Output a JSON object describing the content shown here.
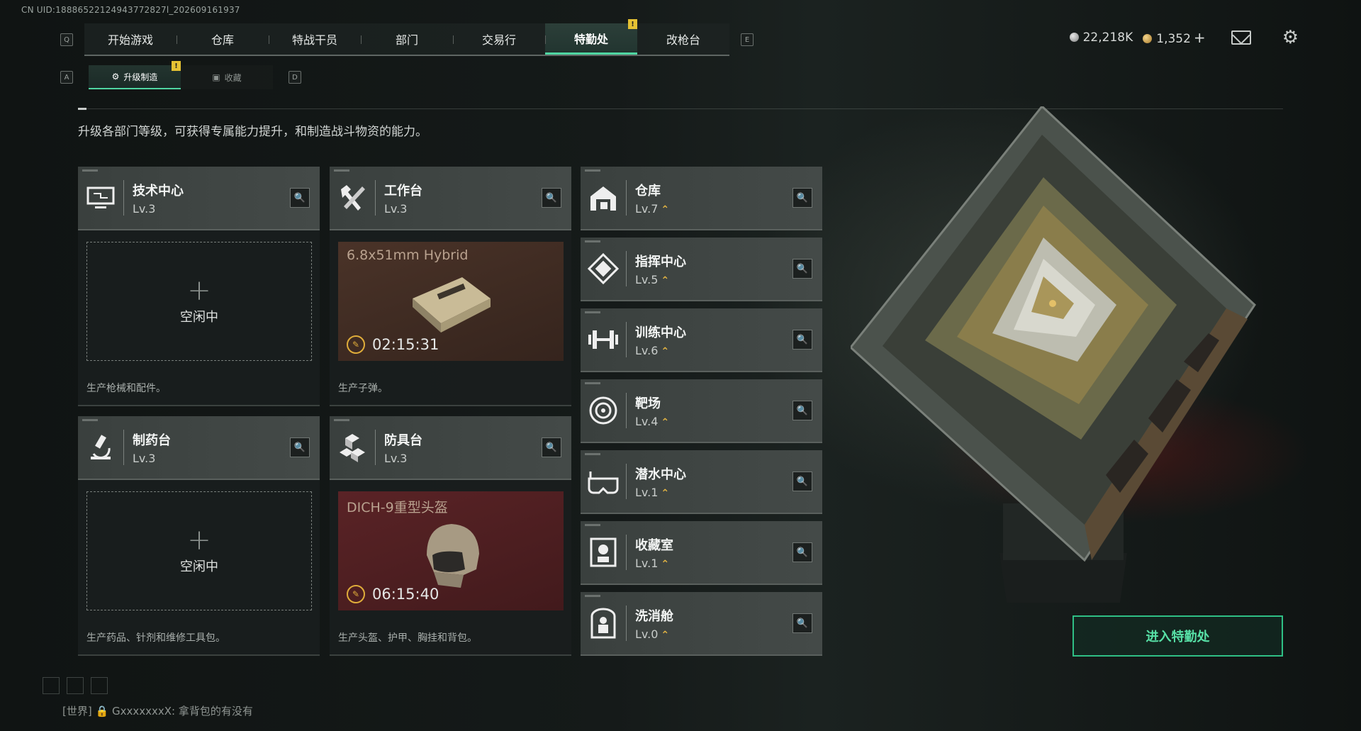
{
  "uid": "CN UID:18886522124943772827l_202609161937",
  "nav": {
    "left_key": "Q",
    "right_key": "E",
    "tabs": [
      {
        "label": "开始游戏"
      },
      {
        "label": "仓库"
      },
      {
        "label": "特战干员"
      },
      {
        "label": "部门"
      },
      {
        "label": "交易行"
      },
      {
        "label": "特勤处",
        "active": true,
        "badge": "!"
      },
      {
        "label": "改枪台"
      }
    ]
  },
  "currency": {
    "silver": "22,218K",
    "gold": "1,352",
    "plus": "+"
  },
  "subnav": {
    "left_key": "A",
    "right_key": "D",
    "tabs": [
      {
        "label": "升级制造",
        "active": true,
        "badge": "!"
      },
      {
        "label": "收藏"
      }
    ]
  },
  "description": "升级各部门等级，可获得专属能力提升，和制造战斗物资的能力。",
  "production": [
    {
      "name": "技术中心",
      "level": "Lv.3",
      "icon": "computer-icon",
      "status": "空闲中",
      "desc": "生产枪械和配件。"
    },
    {
      "name": "工作台",
      "level": "Lv.3",
      "icon": "hammer-wrench-icon",
      "item": "6.8x51mm Hybrid",
      "timer": "02:15:31",
      "desc": "生产子弹。",
      "bg": "#3e2a22"
    },
    {
      "name": "制药台",
      "level": "Lv.3",
      "icon": "microscope-icon",
      "status": "空闲中",
      "desc": "生产药品、针剂和维修工具包。"
    },
    {
      "name": "防具台",
      "level": "Lv.3",
      "icon": "armor-blocks-icon",
      "item": "DICH-9重型头盔",
      "timer": "06:15:40",
      "desc": "生产头盔、护甲、胸挂和背包。",
      "bg": "#4a1f1f"
    }
  ],
  "facilities": [
    {
      "name": "仓库",
      "level": "Lv.7",
      "icon": "warehouse-icon"
    },
    {
      "name": "指挥中心",
      "level": "Lv.5",
      "icon": "command-chip-icon"
    },
    {
      "name": "训练中心",
      "level": "Lv.6",
      "icon": "dumbbell-icon"
    },
    {
      "name": "靶场",
      "level": "Lv.4",
      "icon": "target-icon"
    },
    {
      "name": "潜水中心",
      "level": "Lv.1",
      "icon": "dive-goggles-icon"
    },
    {
      "name": "收藏室",
      "level": "Lv.1",
      "icon": "collection-bust-icon"
    },
    {
      "name": "洗消舱",
      "level": "Lv.0",
      "icon": "decon-suit-icon"
    }
  ],
  "enter_button": "进入特勤处",
  "chat": {
    "channel": "[世界]",
    "user": "GxxxxxxxX:",
    "message": "拿背包的有没有"
  },
  "colors": {
    "accent": "#4fd6a2",
    "badge": "#e5c233",
    "upgrade_arrow": "#e3b443"
  }
}
